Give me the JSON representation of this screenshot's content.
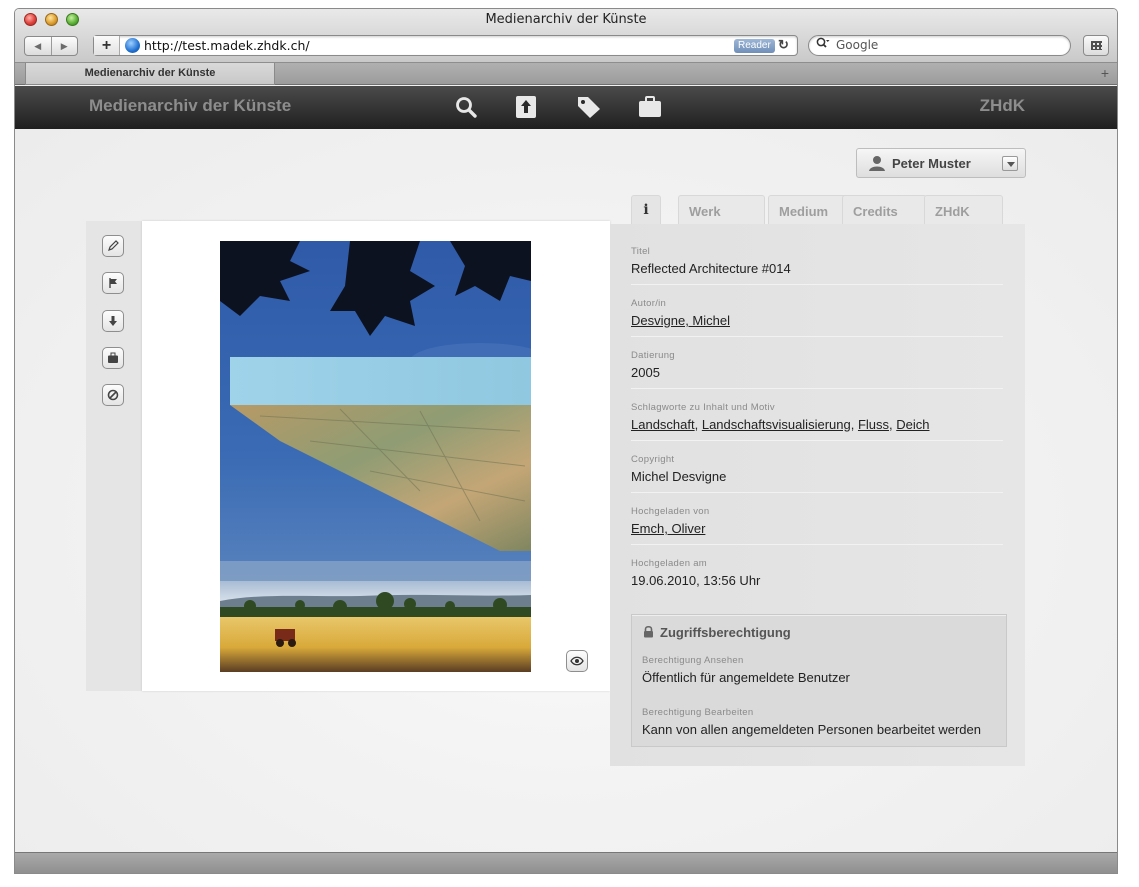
{
  "window": {
    "title": "Medienarchiv der Künste",
    "url": "http://test.madek.zhdk.ch/",
    "reader_label": "Reader",
    "search_placeholder": "Google",
    "tab_label": "Medienarchiv der Künste"
  },
  "header": {
    "title": "Medienarchiv der Künste",
    "brand": "ZHdK",
    "icons": [
      "search-icon",
      "upload-icon",
      "tag-icon",
      "briefcase-icon"
    ]
  },
  "user": {
    "name": "Peter Muster"
  },
  "tabs": [
    {
      "label": "i",
      "active": true
    },
    {
      "label": "Werk",
      "active": false
    },
    {
      "label": "Medium",
      "active": false
    },
    {
      "label": "Credits",
      "active": false
    },
    {
      "label": "ZHdK",
      "active": false
    }
  ],
  "toolbar": [
    "edit-icon",
    "flag-icon",
    "download-icon",
    "briefcase-icon",
    "block-icon"
  ],
  "metadata": {
    "title": {
      "label": "Titel",
      "value": "Reflected Architecture #014"
    },
    "author": {
      "label": "Autor/in",
      "value": "Desvigne, Michel"
    },
    "date": {
      "label": "Datierung",
      "value": "2005"
    },
    "keywords": {
      "label": "Schlagworte zu Inhalt und Motiv",
      "values": [
        "Landschaft",
        "Landschaftsvisualisierung",
        "Fluss",
        "Deich"
      ]
    },
    "copyright": {
      "label": "Copyright",
      "value": "Michel Desvigne"
    },
    "uploaded_by": {
      "label": "Hochgeladen von",
      "value": "Emch, Oliver"
    },
    "uploaded_at": {
      "label": "Hochgeladen am",
      "value": "19.06.2010, 13:56 Uhr"
    }
  },
  "access": {
    "title": "Zugriffsberechtigung",
    "view": {
      "label": "Berechtigung Ansehen",
      "value": "Öffentlich für angemeldete Benutzer"
    },
    "edit": {
      "label": "Berechtigung Bearbeiten",
      "value": "Kann von allen angemeldeten Personen bearbeitet werden"
    }
  },
  "colors": {
    "header_bg": "#2b2b2b",
    "panel_bg": "#e5e5e5",
    "accent": "#1f6fd0"
  }
}
